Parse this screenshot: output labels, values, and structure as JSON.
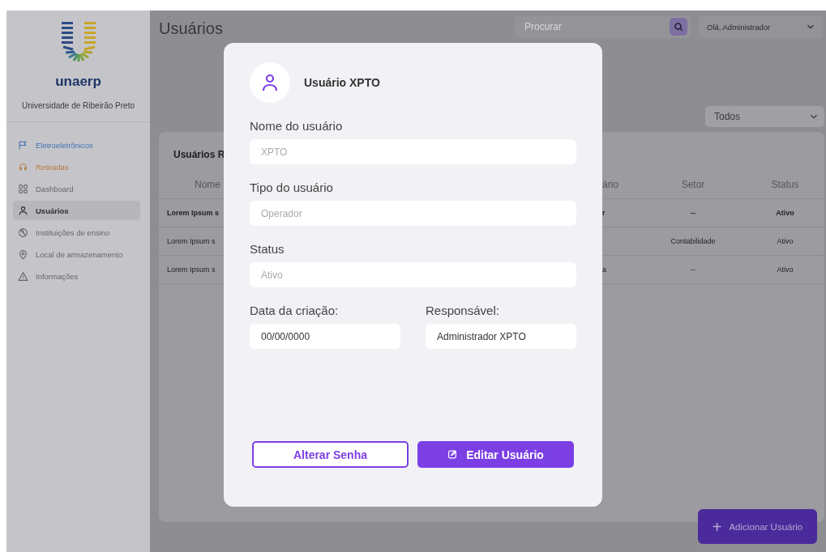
{
  "sidebar": {
    "brand": "unaerp",
    "subtitle": "Universidade de Ribeirão Preto",
    "items": [
      {
        "label": "Eletroeletrônicos",
        "selected": false,
        "color": "#3f70b0"
      },
      {
        "label": "Retiradas",
        "selected": false,
        "color": "#b8773f"
      },
      {
        "label": "Dashboard",
        "selected": false,
        "color": "#66666a"
      },
      {
        "label": "Usuários",
        "selected": true,
        "color": "#2e2e32"
      },
      {
        "label": "Instituições de ensino",
        "selected": false,
        "color": "#66666a"
      },
      {
        "label": "Local de armazenamento",
        "selected": false,
        "color": "#66666a"
      },
      {
        "label": "Informações",
        "selected": false,
        "color": "#66666a"
      }
    ]
  },
  "header": {
    "title": "Usuários",
    "search": {
      "placeholder": "Procurar"
    },
    "user_menu": "Olá, Administrador"
  },
  "filter": {
    "value": "Todos"
  },
  "table": {
    "title": "Usuários R",
    "columns": [
      "Nome",
      "ário",
      "Setor",
      "Status"
    ],
    "rows": [
      {
        "selected": true,
        "cells": [
          "Lorem Ipsum s",
          "r",
          "--",
          "Ativo"
        ]
      },
      {
        "selected": false,
        "cells": [
          "Lorem Ipsum s",
          null,
          "Contabilidade",
          "Ativo"
        ]
      },
      {
        "selected": false,
        "cells": [
          "Lorem Ipsum s",
          "a",
          "--",
          "Ativo"
        ]
      }
    ]
  },
  "add_button": {
    "label": "Adicionar Usuário",
    "icon": "+"
  },
  "modal": {
    "title": "Usuário XPTO",
    "fields": [
      {
        "label": "Nome do usuário",
        "placeholder": "XPTO"
      },
      {
        "label": "Tipo do usuário",
        "placeholder": "Operador"
      },
      {
        "label": "Status",
        "placeholder": "Ativo"
      }
    ],
    "fields_row": [
      {
        "label": "Data da criação:",
        "value": "00/00/0000"
      },
      {
        "label": "Responsável:",
        "value": "Administrador XPTO"
      }
    ],
    "buttons": [
      {
        "label": "Alterar Senha",
        "kind": "outline"
      },
      {
        "label": "Editar Usuário",
        "kind": "primary"
      }
    ]
  }
}
